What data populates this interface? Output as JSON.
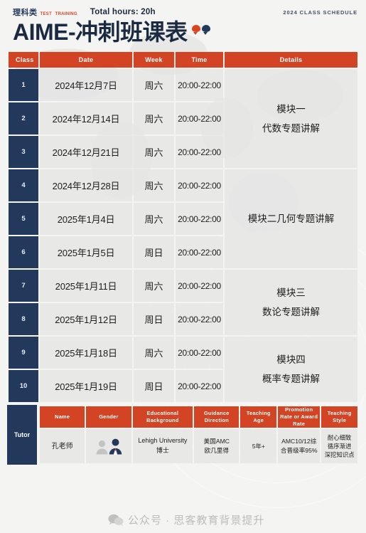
{
  "header": {
    "brand_cn": "理科类",
    "brand_en_line1": "TEST",
    "brand_en_line2": "TRAINING",
    "total_hours": "Total hours: 20h",
    "schedule_tag": "2024 CLASS SCHEDULE",
    "title": "AIME-冲刺班课表"
  },
  "colors": {
    "accent_red": "#d34425",
    "accent_navy": "#23395b",
    "cell_grey": "#e4e4e4"
  },
  "schedule": {
    "columns": {
      "class": "Class",
      "date": "Date",
      "week": "Week",
      "time": "Time",
      "details": "Details"
    },
    "rows": [
      {
        "no": "1",
        "date": "2024年12月7日",
        "week": "周六",
        "time": "20:00-22:00"
      },
      {
        "no": "2",
        "date": "2024年12月14日",
        "week": "周六",
        "time": "20:00-22:00"
      },
      {
        "no": "3",
        "date": "2024年12月21日",
        "week": "周六",
        "time": "20:00-22:00"
      },
      {
        "no": "4",
        "date": "2024年12月28日",
        "week": "周六",
        "time": "20:00-22:00"
      },
      {
        "no": "5",
        "date": "2025年1月4日",
        "week": "周六",
        "time": "20:00-22:00"
      },
      {
        "no": "6",
        "date": "2025年1月5日",
        "week": "周日",
        "time": "20:00-22:00"
      },
      {
        "no": "7",
        "date": "2025年1月11日",
        "week": "周六",
        "time": "20:00-22:00"
      },
      {
        "no": "8",
        "date": "2025年1月12日",
        "week": "周日",
        "time": "20:00-22:00"
      },
      {
        "no": "9",
        "date": "2025年1月18日",
        "week": "周六",
        "time": "20:00-22:00"
      },
      {
        "no": "10",
        "date": "2025年1月19日",
        "week": "周日",
        "time": "20:00-22:00"
      }
    ],
    "modules": [
      {
        "span": 3,
        "line1": "模块一",
        "line2": "代数专题讲解"
      },
      {
        "span": 3,
        "line1": "模块二几何专题讲解",
        "line2": ""
      },
      {
        "span": 2,
        "line1": "模块三",
        "line2": "数论专题讲解"
      },
      {
        "span": 2,
        "line1": "模块四",
        "line2": "概率专题讲解"
      }
    ]
  },
  "tutor": {
    "label": "Tutor",
    "columns": {
      "name": "Name",
      "gender": "Gender",
      "education_l1": "Educational",
      "education_l2": "Background",
      "direction_l1": "Guidance",
      "direction_l2": "Direction",
      "age_l1": "Teaching",
      "age_l2": "Age",
      "rate_l1": "Promotion Rate",
      "rate_l2": "or Award Rate",
      "style_l1": "Teaching",
      "style_l2": "Style"
    },
    "row": {
      "name": "孔老师",
      "gender_icon": "male-female-icon",
      "education_l1": "Lehigh University",
      "education_l2": "博士",
      "direction_l1": "美国AMC",
      "direction_l2": "欧几里得",
      "age": "5年+",
      "rate_l1": "AMC10/12综",
      "rate_l2": "合晋级率95%",
      "style_l1": "耐心细致",
      "style_l2": "循序渐进",
      "style_l3": "深挖知识点"
    }
  },
  "watermark": {
    "text": "公众号 · 思客教育背景提升"
  }
}
